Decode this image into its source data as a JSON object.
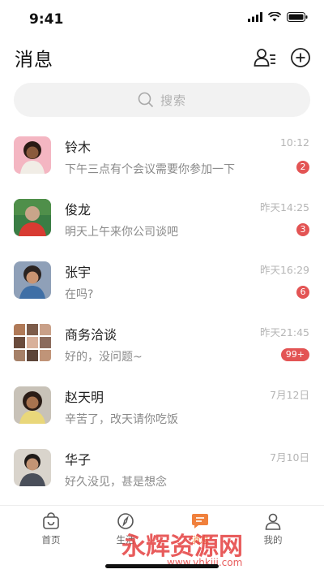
{
  "status_bar": {
    "time": "9:41"
  },
  "header": {
    "title": "消息",
    "contacts_icon": "contacts-icon",
    "add_icon": "plus-circle-icon"
  },
  "search": {
    "placeholder": "搜索",
    "icon": "search-icon"
  },
  "chats": [
    {
      "name": "铃木",
      "time": "10:12",
      "message": "下午三点有个会议需要你参加一下",
      "unread": "2",
      "avatar_color": "#f4b6c2"
    },
    {
      "name": "俊龙",
      "time": "昨天14:25",
      "message": "明天上午来你公司谈吧",
      "unread": "3",
      "avatar_color": "#3a7d44"
    },
    {
      "name": "张宇",
      "time": "昨天16:29",
      "message": "在吗?",
      "unread": "6",
      "avatar_color": "#8fa0b8"
    },
    {
      "name": "商务洽谈",
      "time": "昨天21:45",
      "message": "好的，没问题~",
      "unread": "99+",
      "avatar_color": "#9a7b6a"
    },
    {
      "name": "赵天明",
      "time": "7月12日",
      "message": "辛苦了，改天请你吃饭",
      "unread": "",
      "avatar_color": "#c8c2b8"
    },
    {
      "name": "华子",
      "time": "7月10日",
      "message": "好久没见，甚是想念",
      "unread": "",
      "avatar_color": "#d9d4cc"
    }
  ],
  "tabs": [
    {
      "label": "首页",
      "icon": "bag-icon",
      "active": false
    },
    {
      "label": "生活",
      "icon": "compass-icon",
      "active": false
    },
    {
      "label": "消息",
      "icon": "chat-bubble-icon",
      "active": true
    },
    {
      "label": "我的",
      "icon": "person-icon",
      "active": false
    }
  ],
  "watermark": {
    "text": "永辉资源网",
    "url": "www.yhkjjj.com"
  },
  "colors": {
    "accent": "#f0803c",
    "badge": "#e35454",
    "search_bg": "#f2f2f2"
  }
}
